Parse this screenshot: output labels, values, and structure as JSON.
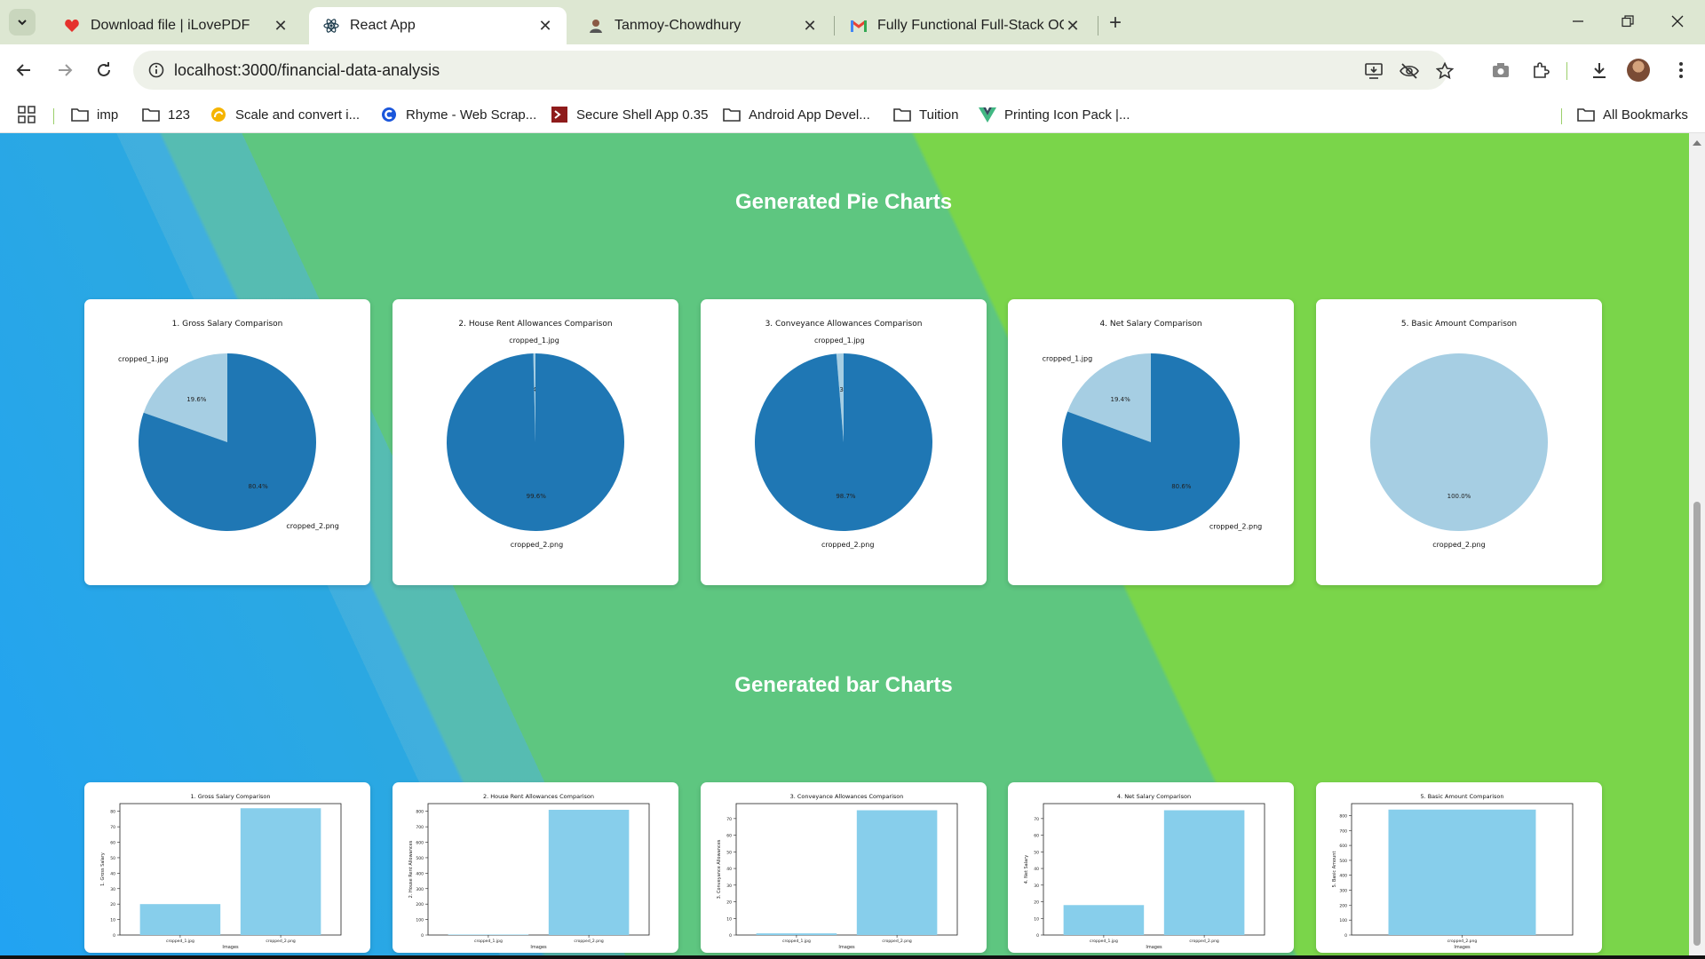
{
  "browser": {
    "tabs": [
      {
        "title": "Download file | iLovePDF",
        "favicon": "heart-icon"
      },
      {
        "title": "React App",
        "favicon": "react-icon"
      },
      {
        "title": "Tanmoy-Chowdhury",
        "favicon": "person-icon"
      },
      {
        "title": "Fully Functional Full-Stack OCR",
        "favicon": "gmail-icon"
      }
    ],
    "url": "localhost:3000/financial-data-analysis",
    "bookmarks": [
      {
        "label": "imp",
        "icon": "folder-icon"
      },
      {
        "label": "123",
        "icon": "folder-icon"
      },
      {
        "label": "Scale and convert i...",
        "icon": "scale-icon"
      },
      {
        "label": "Rhyme - Web Scrap...",
        "icon": "rhyme-icon"
      },
      {
        "label": "Secure Shell App 0.35",
        "icon": "ssh-icon"
      },
      {
        "label": "Android App Devel...",
        "icon": "folder-icon"
      },
      {
        "label": "Tuition",
        "icon": "folder-icon"
      },
      {
        "label": "Printing Icon Pack |...",
        "icon": "vue-icon"
      }
    ],
    "all_bookmarks": "All Bookmarks",
    "colors": {
      "tabstrip": "#dde7d2",
      "accent": "#7ad54a",
      "pie_dark": "#1f77b4",
      "pie_light": "#a6cee3",
      "bar": "#87ceeb"
    }
  },
  "page": {
    "pie_section_title": "Generated Pie Charts",
    "bar_section_title": "Generated bar Charts"
  },
  "chart_data": [
    {
      "type": "pie",
      "title": "1. Gross Salary Comparison",
      "labels": [
        "cropped_1.jpg",
        "cropped_2.png"
      ],
      "values": [
        19.6,
        80.4
      ],
      "autopct": [
        "19.6%",
        "80.4%"
      ]
    },
    {
      "type": "pie",
      "title": "2. House Rent Allowances Comparison",
      "labels": [
        "cropped_1.jpg",
        "cropped_2.png"
      ],
      "values": [
        0.4,
        99.6
      ],
      "autopct": [
        "0.4%",
        "99.6%"
      ]
    },
    {
      "type": "pie",
      "title": "3. Conveyance Allowances Comparison",
      "labels": [
        "cropped_1.jpg",
        "cropped_2.png"
      ],
      "values": [
        1.3,
        98.7
      ],
      "autopct": [
        "1.3%",
        "98.7%"
      ]
    },
    {
      "type": "pie",
      "title": "4. Net Salary Comparison",
      "labels": [
        "cropped_1.jpg",
        "cropped_2.png"
      ],
      "values": [
        19.4,
        80.6
      ],
      "autopct": [
        "19.4%",
        "80.6%"
      ]
    },
    {
      "type": "pie",
      "title": "5. Basic Amount Comparison",
      "labels": [
        "cropped_2.png"
      ],
      "values": [
        100.0
      ],
      "autopct": [
        "100.0%"
      ]
    },
    {
      "type": "bar",
      "title": "1. Gross Salary Comparison",
      "categories": [
        "cropped_1.jpg",
        "cropped_2.png"
      ],
      "values": [
        20,
        82
      ],
      "xlabel": "Images",
      "ylabel": "1. Gross Salary",
      "ylim": [
        0,
        85
      ],
      "yticks": [
        0,
        10,
        20,
        30,
        40,
        50,
        60,
        70,
        80
      ]
    },
    {
      "type": "bar",
      "title": "2. House Rent Allowances Comparison",
      "categories": [
        "cropped_1.jpg",
        "cropped_2.png"
      ],
      "values": [
        3,
        810
      ],
      "xlabel": "Images",
      "ylabel": "2. House Rent Allowances",
      "ylim": [
        0,
        850
      ],
      "yticks": [
        0,
        100,
        200,
        300,
        400,
        500,
        600,
        700,
        800
      ]
    },
    {
      "type": "bar",
      "title": "3. Conveyance Allowances Comparison",
      "categories": [
        "cropped_1.jpg",
        "cropped_2.png"
      ],
      "values": [
        1,
        75
      ],
      "xlabel": "Images",
      "ylabel": "3. Conveyance Allowances",
      "ylim": [
        0,
        79
      ],
      "yticks": [
        0,
        10,
        20,
        30,
        40,
        50,
        60,
        70
      ]
    },
    {
      "type": "bar",
      "title": "4. Net Salary Comparison",
      "categories": [
        "cropped_1.jpg",
        "cropped_2.png"
      ],
      "values": [
        18,
        75
      ],
      "xlabel": "Images",
      "ylabel": "4. Net Salary",
      "ylim": [
        0,
        79
      ],
      "yticks": [
        0,
        10,
        20,
        30,
        40,
        50,
        60,
        70
      ]
    },
    {
      "type": "bar",
      "title": "5. Basic Amount Comparison",
      "categories": [
        "cropped_2.png"
      ],
      "values": [
        840
      ],
      "xlabel": "Images",
      "ylabel": "5. Basic Amount",
      "ylim": [
        0,
        880
      ],
      "yticks": [
        0,
        100,
        200,
        300,
        400,
        500,
        600,
        700,
        800
      ]
    }
  ]
}
